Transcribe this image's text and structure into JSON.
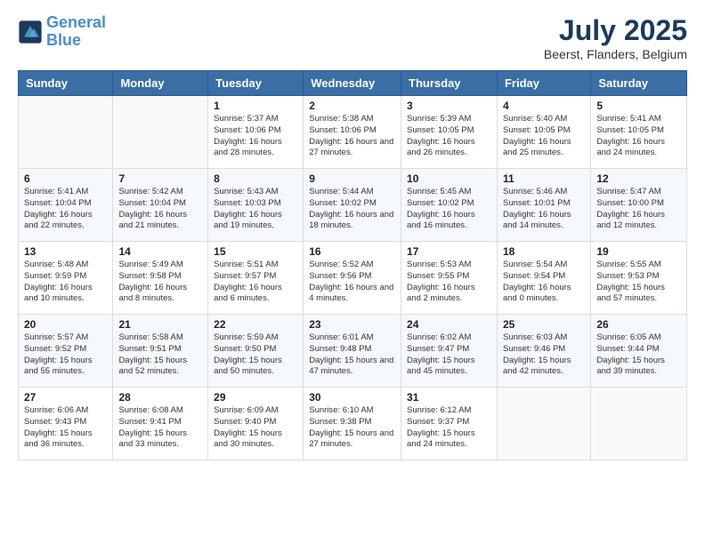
{
  "header": {
    "logo_line1": "General",
    "logo_line2": "Blue",
    "month_title": "July 2025",
    "location": "Beerst, Flanders, Belgium"
  },
  "days_of_week": [
    "Sunday",
    "Monday",
    "Tuesday",
    "Wednesday",
    "Thursday",
    "Friday",
    "Saturday"
  ],
  "weeks": [
    [
      {
        "num": "",
        "info": ""
      },
      {
        "num": "",
        "info": ""
      },
      {
        "num": "1",
        "info": "Sunrise: 5:37 AM\nSunset: 10:06 PM\nDaylight: 16 hours\nand 28 minutes."
      },
      {
        "num": "2",
        "info": "Sunrise: 5:38 AM\nSunset: 10:06 PM\nDaylight: 16 hours\nand 27 minutes."
      },
      {
        "num": "3",
        "info": "Sunrise: 5:39 AM\nSunset: 10:05 PM\nDaylight: 16 hours\nand 26 minutes."
      },
      {
        "num": "4",
        "info": "Sunrise: 5:40 AM\nSunset: 10:05 PM\nDaylight: 16 hours\nand 25 minutes."
      },
      {
        "num": "5",
        "info": "Sunrise: 5:41 AM\nSunset: 10:05 PM\nDaylight: 16 hours\nand 24 minutes."
      }
    ],
    [
      {
        "num": "6",
        "info": "Sunrise: 5:41 AM\nSunset: 10:04 PM\nDaylight: 16 hours\nand 22 minutes."
      },
      {
        "num": "7",
        "info": "Sunrise: 5:42 AM\nSunset: 10:04 PM\nDaylight: 16 hours\nand 21 minutes."
      },
      {
        "num": "8",
        "info": "Sunrise: 5:43 AM\nSunset: 10:03 PM\nDaylight: 16 hours\nand 19 minutes."
      },
      {
        "num": "9",
        "info": "Sunrise: 5:44 AM\nSunset: 10:02 PM\nDaylight: 16 hours\nand 18 minutes."
      },
      {
        "num": "10",
        "info": "Sunrise: 5:45 AM\nSunset: 10:02 PM\nDaylight: 16 hours\nand 16 minutes."
      },
      {
        "num": "11",
        "info": "Sunrise: 5:46 AM\nSunset: 10:01 PM\nDaylight: 16 hours\nand 14 minutes."
      },
      {
        "num": "12",
        "info": "Sunrise: 5:47 AM\nSunset: 10:00 PM\nDaylight: 16 hours\nand 12 minutes."
      }
    ],
    [
      {
        "num": "13",
        "info": "Sunrise: 5:48 AM\nSunset: 9:59 PM\nDaylight: 16 hours\nand 10 minutes."
      },
      {
        "num": "14",
        "info": "Sunrise: 5:49 AM\nSunset: 9:58 PM\nDaylight: 16 hours\nand 8 minutes."
      },
      {
        "num": "15",
        "info": "Sunrise: 5:51 AM\nSunset: 9:57 PM\nDaylight: 16 hours\nand 6 minutes."
      },
      {
        "num": "16",
        "info": "Sunrise: 5:52 AM\nSunset: 9:56 PM\nDaylight: 16 hours\nand 4 minutes."
      },
      {
        "num": "17",
        "info": "Sunrise: 5:53 AM\nSunset: 9:55 PM\nDaylight: 16 hours\nand 2 minutes."
      },
      {
        "num": "18",
        "info": "Sunrise: 5:54 AM\nSunset: 9:54 PM\nDaylight: 16 hours\nand 0 minutes."
      },
      {
        "num": "19",
        "info": "Sunrise: 5:55 AM\nSunset: 9:53 PM\nDaylight: 15 hours\nand 57 minutes."
      }
    ],
    [
      {
        "num": "20",
        "info": "Sunrise: 5:57 AM\nSunset: 9:52 PM\nDaylight: 15 hours\nand 55 minutes."
      },
      {
        "num": "21",
        "info": "Sunrise: 5:58 AM\nSunset: 9:51 PM\nDaylight: 15 hours\nand 52 minutes."
      },
      {
        "num": "22",
        "info": "Sunrise: 5:59 AM\nSunset: 9:50 PM\nDaylight: 15 hours\nand 50 minutes."
      },
      {
        "num": "23",
        "info": "Sunrise: 6:01 AM\nSunset: 9:48 PM\nDaylight: 15 hours\nand 47 minutes."
      },
      {
        "num": "24",
        "info": "Sunrise: 6:02 AM\nSunset: 9:47 PM\nDaylight: 15 hours\nand 45 minutes."
      },
      {
        "num": "25",
        "info": "Sunrise: 6:03 AM\nSunset: 9:46 PM\nDaylight: 15 hours\nand 42 minutes."
      },
      {
        "num": "26",
        "info": "Sunrise: 6:05 AM\nSunset: 9:44 PM\nDaylight: 15 hours\nand 39 minutes."
      }
    ],
    [
      {
        "num": "27",
        "info": "Sunrise: 6:06 AM\nSunset: 9:43 PM\nDaylight: 15 hours\nand 36 minutes."
      },
      {
        "num": "28",
        "info": "Sunrise: 6:08 AM\nSunset: 9:41 PM\nDaylight: 15 hours\nand 33 minutes."
      },
      {
        "num": "29",
        "info": "Sunrise: 6:09 AM\nSunset: 9:40 PM\nDaylight: 15 hours\nand 30 minutes."
      },
      {
        "num": "30",
        "info": "Sunrise: 6:10 AM\nSunset: 9:38 PM\nDaylight: 15 hours\nand 27 minutes."
      },
      {
        "num": "31",
        "info": "Sunrise: 6:12 AM\nSunset: 9:37 PM\nDaylight: 15 hours\nand 24 minutes."
      },
      {
        "num": "",
        "info": ""
      },
      {
        "num": "",
        "info": ""
      }
    ]
  ]
}
